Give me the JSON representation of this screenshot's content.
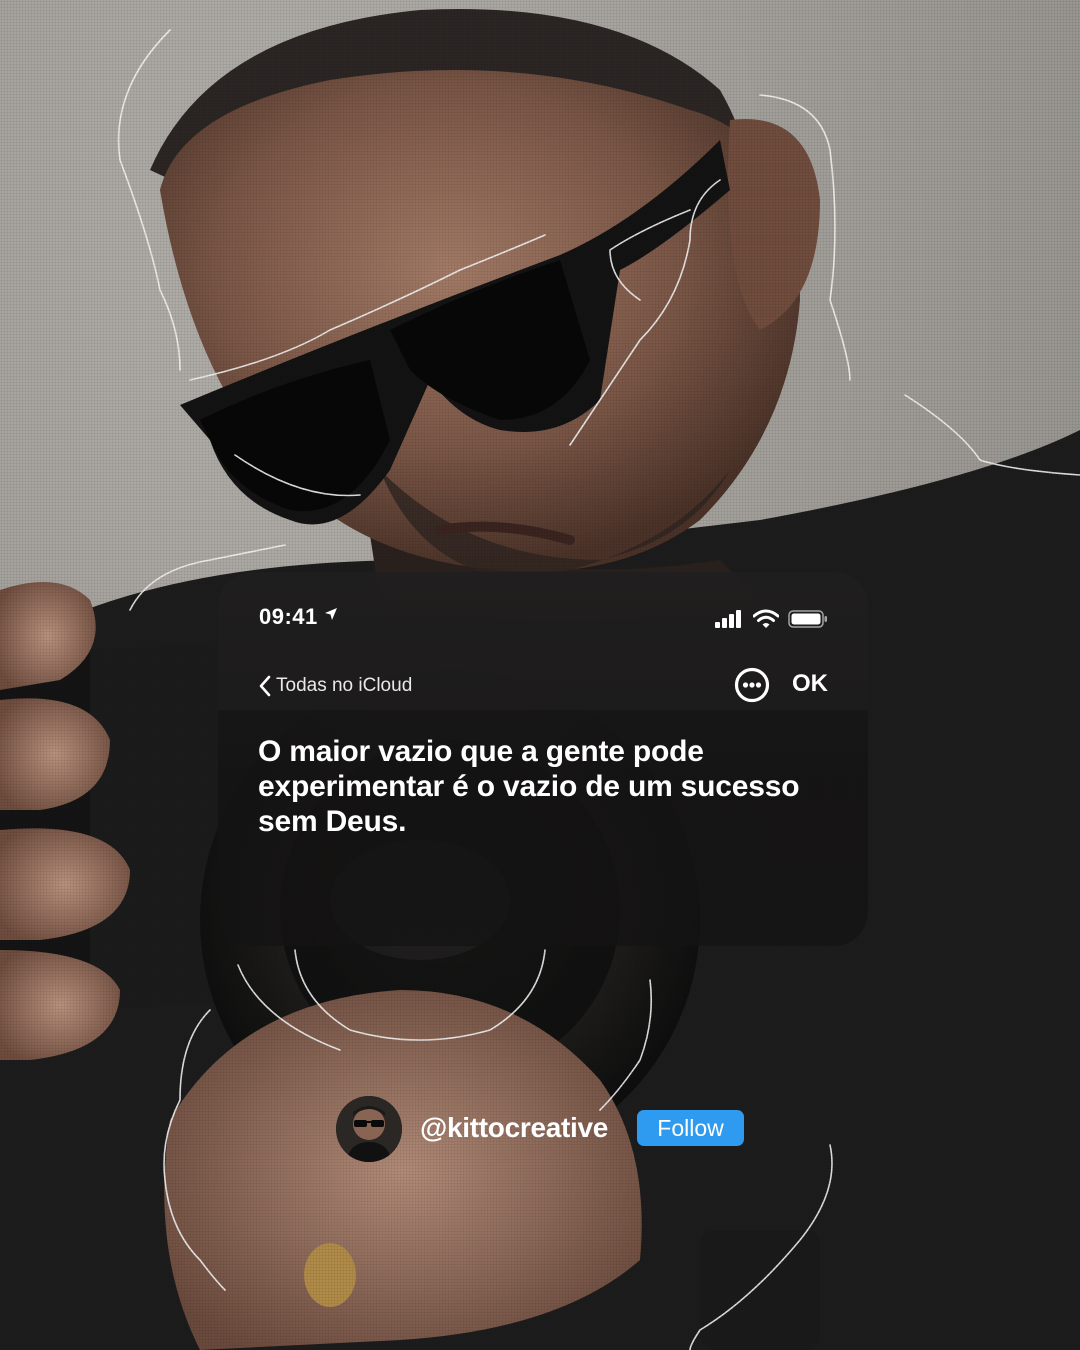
{
  "status_bar": {
    "time": "09:41",
    "icons": [
      "location-arrow-icon",
      "signal-icon",
      "wifi-icon",
      "battery-icon"
    ]
  },
  "nav": {
    "back_label": "Todas no iCloud",
    "more_icon": "ellipsis-circle-icon",
    "ok_label": "OK"
  },
  "note": {
    "text": "O maior vazio que a gente pode experimentar é o vazio de um sucesso sem Deus."
  },
  "profile": {
    "handle": "@kittocreative",
    "follow_label": "Follow",
    "follow_color": "#2e9bf0"
  },
  "colors": {
    "background": "#9a9894",
    "card": "#1c1b1b",
    "text": "#ffffff",
    "accent": "#2e9bf0"
  }
}
